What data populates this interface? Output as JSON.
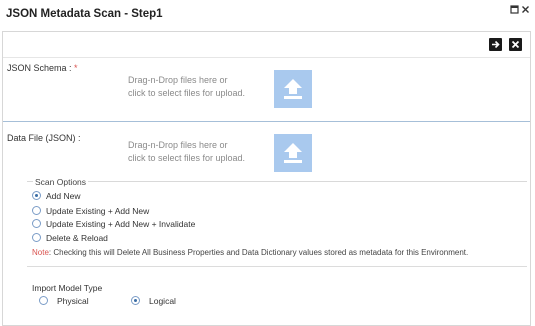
{
  "window": {
    "title": "JSON Metadata Scan - Step1",
    "maximize_icon": "maximize-icon",
    "close_icon": "close-icon"
  },
  "toolbar": {
    "next_icon": "arrow-right-icon",
    "close_icon": "close-x-icon"
  },
  "schema": {
    "label": "JSON Schema",
    "required_mark": "*",
    "drop_line1": "Drag-n-Drop files here or",
    "drop_line2": "click to select files for upload."
  },
  "datafile": {
    "label": "Data File (JSON) :",
    "drop_line1": "Drag-n-Drop files here or",
    "drop_line2": "click to select files for upload."
  },
  "scan_options": {
    "legend": "Scan Options",
    "options": [
      {
        "label": "Add New",
        "selected": true
      },
      {
        "label": "Update Existing + Add New",
        "selected": false
      },
      {
        "label": "Update Existing + Add New + Invalidate",
        "selected": false
      },
      {
        "label": "Delete & Reload",
        "selected": false
      }
    ],
    "note_label": "Note",
    "note_text": ": Checking this will Delete All Business Properties and Data Dictionary values stored as metadata for this Environment."
  },
  "import_model": {
    "title": "Import Model Type",
    "options": [
      {
        "label": "Physical",
        "selected": false
      },
      {
        "label": "Logical",
        "selected": true
      }
    ]
  },
  "colors": {
    "upload_button": "#a9c9ee",
    "required": "#d9534f",
    "separator": "#a6bfd8"
  }
}
